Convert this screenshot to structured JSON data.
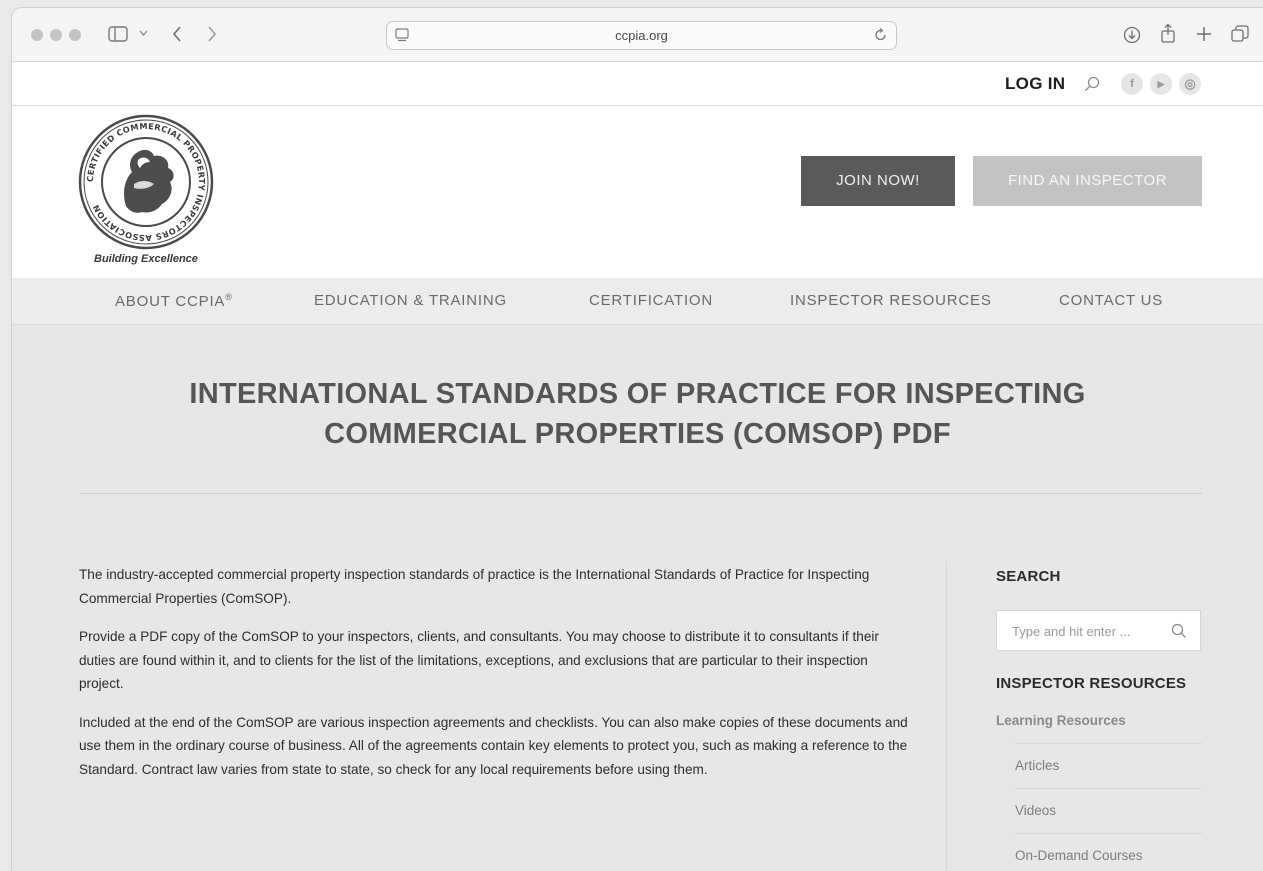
{
  "browser": {
    "url": "ccpia.org"
  },
  "util_bar": {
    "login_label": "LOG IN",
    "social": [
      {
        "name": "facebook-icon",
        "glyph": "f"
      },
      {
        "name": "youtube-icon",
        "glyph": "▶"
      },
      {
        "name": "instagram-icon",
        "glyph": "◎"
      }
    ]
  },
  "header": {
    "logo_text": "CERTIFIED COMMERCIAL PROPERTY INSPECTORS ASSOCIATION",
    "tagline": "Building Excellence",
    "join_label": "JOIN NOW!",
    "find_label": "FIND AN INSPECTOR"
  },
  "nav": {
    "items": [
      {
        "label": "ABOUT CCPIA",
        "sup": "®"
      },
      {
        "label": "EDUCATION & TRAINING"
      },
      {
        "label": "CERTIFICATION"
      },
      {
        "label": "INSPECTOR RESOURCES"
      },
      {
        "label": "CONTACT US"
      }
    ]
  },
  "page": {
    "title_line1": "INTERNATIONAL STANDARDS OF PRACTICE FOR INSPECTING",
    "title_line2": "COMMERCIAL PROPERTIES (COMSOP) PDF",
    "paragraphs": [
      "The industry-accepted commercial property inspection standards of practice is the International Standards of Practice for Inspecting Commercial Properties (ComSOP).",
      "Provide a PDF copy of the ComSOP to your inspectors, clients, and consultants. You may choose to distribute it to consultants if their duties are found within it, and to clients for the list of the limitations, exceptions, and exclusions that are particular to their inspection project.",
      "Included at the end of the ComSOP are various inspection agreements and checklists. You can also make copies of these documents and use them in the ordinary course of business. All of the agreements contain key elements to protect you, such as making a reference to the Standard.  Contract law varies from state to state, so check for any local requirements before using them."
    ]
  },
  "sidebar": {
    "search_heading": "SEARCH",
    "search_placeholder": "Type and hit enter ...",
    "resources_heading": "INSPECTOR RESOURCES",
    "learning_label": "Learning Resources",
    "sub_items": [
      "Articles",
      "Videos",
      "On-Demand Courses"
    ]
  }
}
